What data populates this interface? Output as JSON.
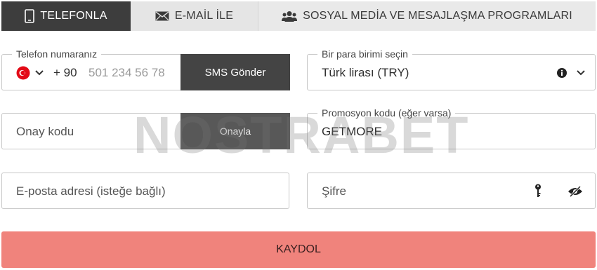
{
  "tabs": [
    {
      "label": "TELEFONLA",
      "icon": "phone-icon",
      "active": true
    },
    {
      "label": "E-MAİL İLE",
      "icon": "envelope-icon",
      "active": false
    },
    {
      "label": "SOSYAL MEDİA VE MESAJLAŞMA PROGRAMLARI",
      "icon": "users-icon",
      "active": false
    }
  ],
  "phone": {
    "legend": "Telefon numaranız",
    "country_flag": "turkey-flag-icon",
    "prefix": "+ 90",
    "placeholder": "501 234 56 78",
    "sms_button": "SMS Gönder"
  },
  "currency": {
    "legend": "Bir para birimi seçin",
    "value": "Türk lirası (TRY)"
  },
  "confirm": {
    "placeholder": "Onay kodu",
    "button": "Onayla"
  },
  "promo": {
    "legend": "Promosyon kodu (eğer varsa)",
    "value": "GETMORE"
  },
  "email": {
    "placeholder": "E-posta adresi (isteğe bağlı)"
  },
  "password": {
    "placeholder": "Şifre"
  },
  "watermark": "NOSTRABET",
  "submit_label": "KAYDOL",
  "colors": {
    "active_tab": "#3d3d3d",
    "inactive_tab": "#e5e5e5",
    "submit": "#f0837c",
    "dark_button": "#444444"
  }
}
